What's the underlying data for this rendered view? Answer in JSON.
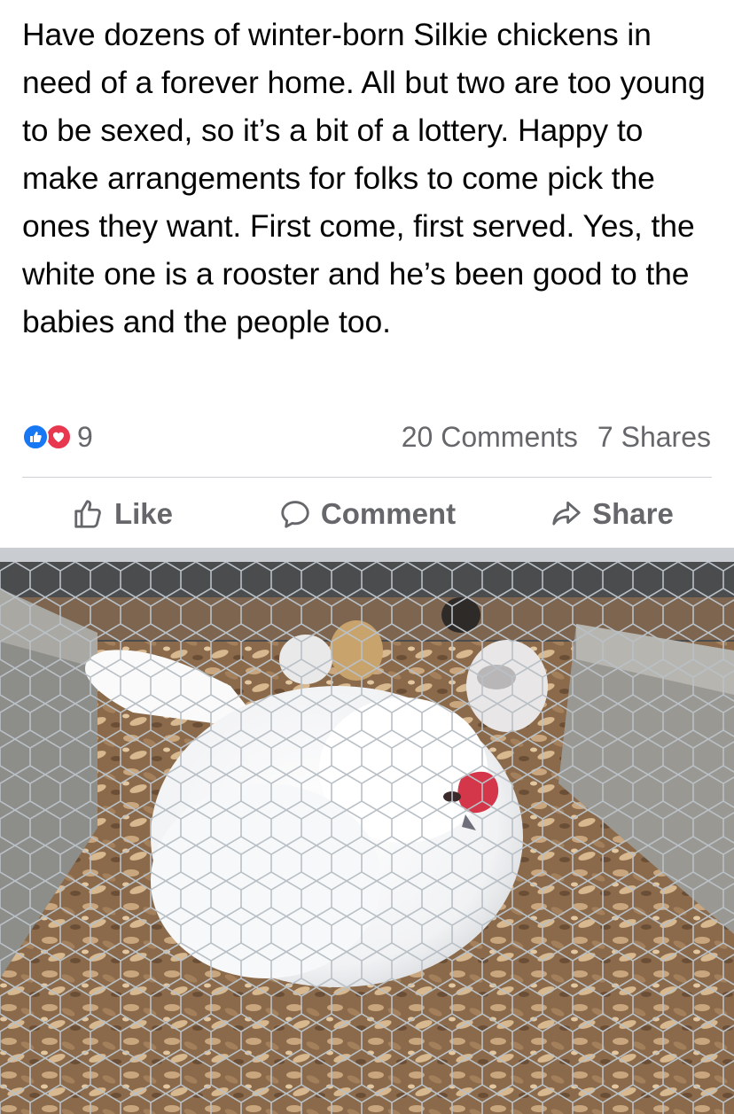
{
  "post": {
    "text": "Have dozens of winter-born Silkie chickens in need of a forever home. All but two are too young to be sexed, so it’s a bit of a lottery. Happy to make arrangements for folks to come pick the ones they want. First come, first served. Yes, the white one is a rooster and he’s been good to the babies and the people too."
  },
  "stats": {
    "reaction_count": "9",
    "comments": "20 Comments",
    "shares": "7 Shares",
    "reaction_icons": [
      "like-icon",
      "love-icon"
    ]
  },
  "actions": {
    "like_label": "Like",
    "comment_label": "Comment",
    "share_label": "Share"
  },
  "colors": {
    "text": "#050505",
    "secondary": "#65676b",
    "like_blue": "#1877f2",
    "love_red": "#e8384f",
    "divider": "#ced0d4"
  }
}
